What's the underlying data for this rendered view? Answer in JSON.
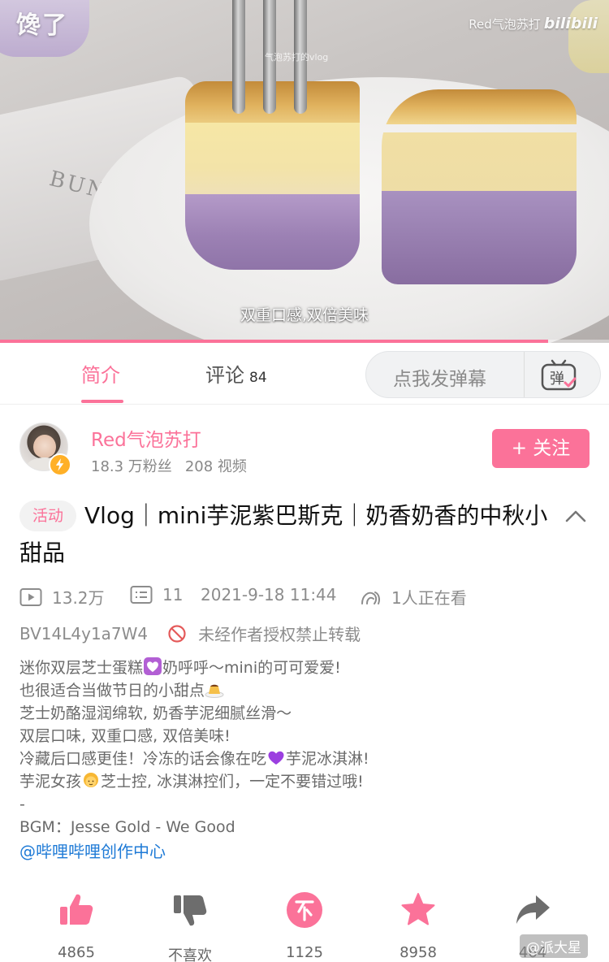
{
  "video": {
    "overlay_left": "馋了",
    "overlay_right_name": "Red气泡苏打",
    "overlay_right_brand": "bilibili",
    "watermark": "气泡苏打的vlog",
    "subtitle": "双重口感,双倍美味",
    "tray_text": "BUNI",
    "progress": 0.9
  },
  "tabs": {
    "intro": "简介",
    "comments": "评论",
    "comments_count": "84",
    "danmaku_placeholder": "点我发弹幕",
    "danmaku_button_glyph": "弹"
  },
  "uploader": {
    "name": "Red气泡苏打",
    "fans": "18.3 万粉丝",
    "videos": "208 视频",
    "follow_label": "+ 关注"
  },
  "video_info": {
    "tag": "活动",
    "title": "Vlog｜mini芋泥紫巴斯克｜奶香奶香的中秋小甜品",
    "views": "13.2万",
    "danmaku_count": "11",
    "datetime": "2021-9-18 11:44",
    "watching": "1人正在看",
    "bvid": "BV14L4y1a7W4",
    "repost_notice": "未经作者授权禁止转载"
  },
  "description": {
    "lines": [
      {
        "before": "迷你双层芝士蛋糕",
        "emoji": "purple-heart-box",
        "after": "奶呼呼～mini的可可爱爱!"
      },
      {
        "before": "也很适合当做节日的小甜点",
        "emoji": "pudding",
        "after": ""
      },
      {
        "before": "芝士奶酪湿润绵软, 奶香芋泥细腻丝滑～",
        "emoji": "",
        "after": ""
      },
      {
        "before": "双层口味, 双重口感, 双倍美味!",
        "emoji": "",
        "after": ""
      },
      {
        "before": "冷藏后口感更佳！冷冻的话会像在吃",
        "emoji": "purple-heart",
        "after": "芋泥冰淇淋!"
      },
      {
        "before": "芋泥女孩",
        "emoji": "girl",
        "after": "芝士控, 冰淇淋控们，一定不要错过哦!"
      },
      {
        "before": "-",
        "emoji": "",
        "after": ""
      },
      {
        "before": "BGM：Jesse Gold - We Good",
        "emoji": "",
        "after": ""
      }
    ],
    "link": "@哔哩哔哩创作中心"
  },
  "actions": [
    {
      "name": "like",
      "icon": "thumbs-up-icon",
      "label": "4865"
    },
    {
      "name": "dislike",
      "icon": "thumbs-down-icon",
      "label": "不喜欢"
    },
    {
      "name": "coin",
      "icon": "coin-icon",
      "label": "1125"
    },
    {
      "name": "favorite",
      "icon": "star-icon",
      "label": "8958"
    },
    {
      "name": "share",
      "icon": "share-icon",
      "label": "464"
    }
  ],
  "weibo_watermark": "@派大星",
  "colors": {
    "accent": "#fb7299",
    "link": "#1e7ad6",
    "muted": "#8c8c8c",
    "icon_gray": "#6d6d6d"
  }
}
